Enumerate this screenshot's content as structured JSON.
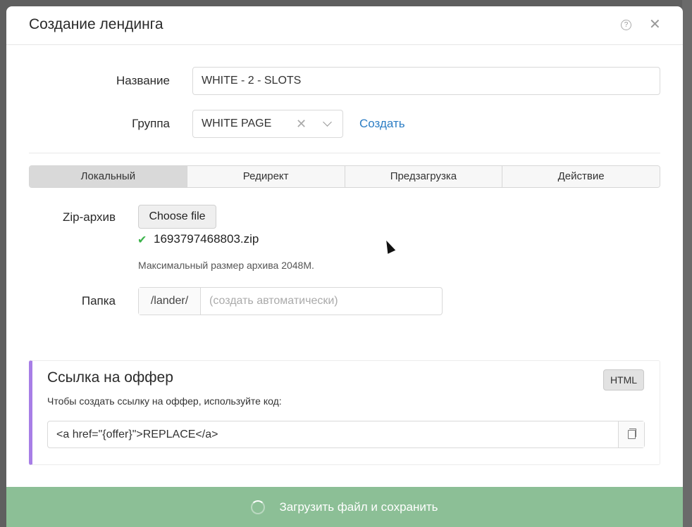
{
  "modal": {
    "title": "Создание лендинга",
    "help_glyph": "?",
    "close_glyph": "✕"
  },
  "form": {
    "name_label": "Название",
    "name_value": "WHITE - 2 - SLOTS",
    "group_label": "Группа",
    "group_value": "WHITE PAGE",
    "group_clear_glyph": "✕",
    "create_link": "Создать"
  },
  "tabs": [
    {
      "label": "Локальный",
      "active": true
    },
    {
      "label": "Редирект",
      "active": false
    },
    {
      "label": "Предзагрузка",
      "active": false
    },
    {
      "label": "Действие",
      "active": false
    }
  ],
  "upload": {
    "zip_label": "Zip-архив",
    "choose_button": "Choose file",
    "check_glyph": "✔",
    "filename": "1693797468803.zip",
    "hint": "Максимальный размер архива 2048M."
  },
  "folder": {
    "label": "Папка",
    "prefix": "/lander/",
    "placeholder": "(создать автоматически)"
  },
  "offer": {
    "title": "Ссылка на оффер",
    "html_button": "HTML",
    "description": "Чтобы создать ссылку на оффер, используйте код:",
    "code": "<a href=\"{offer}\">REPLACE</a>"
  },
  "footer": {
    "save_button": "Загрузить файл и сохранить"
  },
  "colors": {
    "accent_link": "#2c7dc4",
    "offer_border": "#a77ee6",
    "footer_bg": "#8cbf96",
    "check": "#3bb34a"
  }
}
